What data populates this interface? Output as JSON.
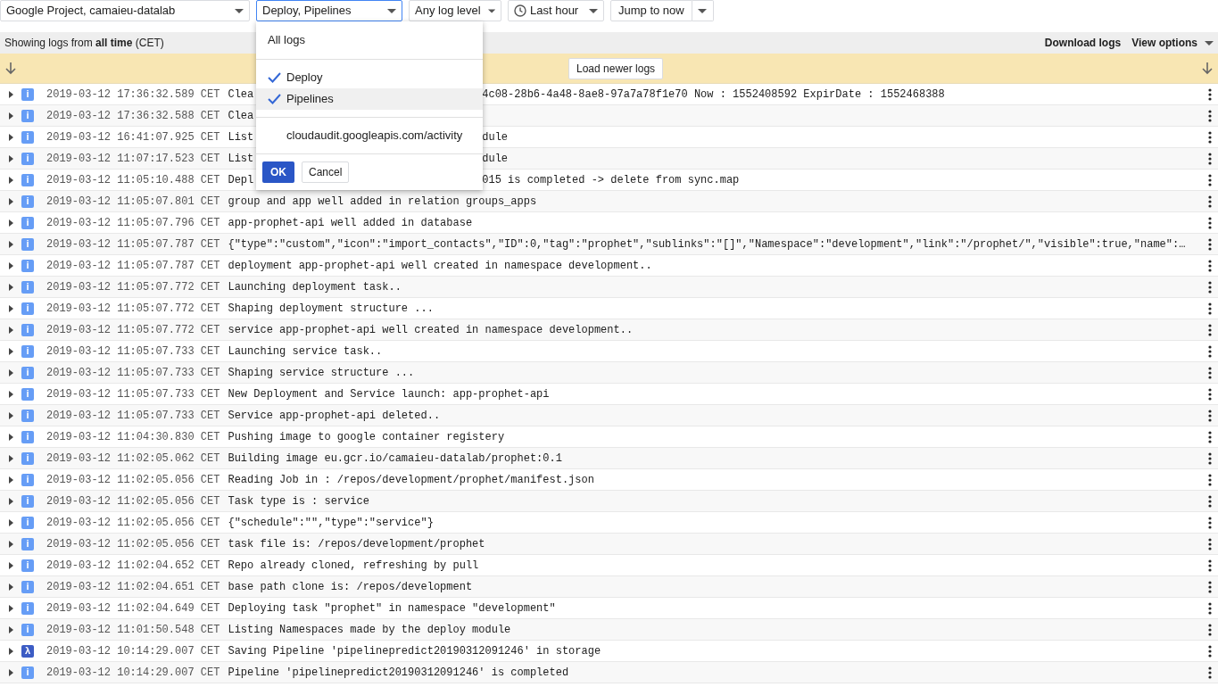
{
  "toolbar": {
    "selects": [
      {
        "label": "Google Project, camaieu-datalab",
        "open": false,
        "kind": "select"
      },
      {
        "label": "Deploy, Pipelines",
        "open": true,
        "kind": "select"
      },
      {
        "label": "Any log level",
        "open": false,
        "kind": "select"
      },
      {
        "label": "Last hour",
        "open": false,
        "kind": "time"
      },
      {
        "label": "Jump to now",
        "open": false,
        "kind": "split"
      }
    ]
  },
  "log_filter_menu": {
    "header": "All logs",
    "options": [
      {
        "label": "Deploy",
        "checked": true,
        "hovered": false
      },
      {
        "label": "Pipelines",
        "checked": true,
        "hovered": true
      },
      {
        "label": "cloudaudit.googleapis.com/activity",
        "checked": false,
        "hovered": false
      }
    ],
    "ok": "OK",
    "cancel": "Cancel"
  },
  "info_bar": {
    "prefix": "Showing logs from ",
    "range": "all time",
    "suffix": " (CET)",
    "actions": [
      "Download logs",
      "View options"
    ]
  },
  "newer_bar": {
    "button": "Load newer logs"
  },
  "rows": [
    {
      "kind": "info",
      "badge": "i",
      "time": "2019-03-12 17:36:32.589 CET",
      "message": "Clea",
      "tail": "4c08-28b6-4a48-8ae8-97a7a78f1e70 Now : 1552408592 ExpirDate : 1552468388"
    },
    {
      "kind": "info",
      "badge": "i",
      "time": "2019-03-12 17:36:32.588 CET",
      "message": "Clea"
    },
    {
      "kind": "info",
      "badge": "i",
      "time": "2019-03-12 16:41:07.925 CET",
      "message": "List",
      "tail": "dule"
    },
    {
      "kind": "info",
      "badge": "i",
      "time": "2019-03-12 11:07:17.523 CET",
      "message": "List",
      "tail": "dule"
    },
    {
      "kind": "info",
      "badge": "i",
      "time": "2019-03-12 11:05:10.488 CET",
      "message": "Depl",
      "tail": "015 is completed -> delete from sync.map"
    },
    {
      "kind": "info",
      "badge": "i",
      "time": "2019-03-12 11:05:07.801 CET",
      "message": "group and app well added in relation groups_apps"
    },
    {
      "kind": "info",
      "badge": "i",
      "time": "2019-03-12 11:05:07.796 CET",
      "message": "app-prophet-api well added in database"
    },
    {
      "kind": "info",
      "badge": "i",
      "time": "2019-03-12 11:05:07.787 CET",
      "message": "{\"type\":\"custom\",\"icon\":\"import_contacts\",\"ID\":0,\"tag\":\"prophet\",\"sublinks\":\"[]\",\"Namespace\":\"development\",\"link\":\"/prophet/\",\"visible\":true,\"name\":…"
    },
    {
      "kind": "info",
      "badge": "i",
      "time": "2019-03-12 11:05:07.787 CET",
      "message": "deployment app-prophet-api well created in namespace development.."
    },
    {
      "kind": "info",
      "badge": "i",
      "time": "2019-03-12 11:05:07.772 CET",
      "message": "Launching deployment task.."
    },
    {
      "kind": "info",
      "badge": "i",
      "time": "2019-03-12 11:05:07.772 CET",
      "message": "Shaping deployment structure ..."
    },
    {
      "kind": "info",
      "badge": "i",
      "time": "2019-03-12 11:05:07.772 CET",
      "message": "service app-prophet-api well created in namespace development.."
    },
    {
      "kind": "info",
      "badge": "i",
      "time": "2019-03-12 11:05:07.733 CET",
      "message": "Launching service task.."
    },
    {
      "kind": "info",
      "badge": "i",
      "time": "2019-03-12 11:05:07.733 CET",
      "message": "Shaping service structure ..."
    },
    {
      "kind": "info",
      "badge": "i",
      "time": "2019-03-12 11:05:07.733 CET",
      "message": "New Deployment and Service launch: app-prophet-api"
    },
    {
      "kind": "info",
      "badge": "i",
      "time": "2019-03-12 11:05:07.733 CET",
      "message": "Service app-prophet-api deleted.."
    },
    {
      "kind": "info",
      "badge": "i",
      "time": "2019-03-12 11:04:30.830 CET",
      "message": "Pushing image to google container registery"
    },
    {
      "kind": "info",
      "badge": "i",
      "time": "2019-03-12 11:02:05.062 CET",
      "message": "Building image eu.gcr.io/camaieu-datalab/prophet:0.1"
    },
    {
      "kind": "info",
      "badge": "i",
      "time": "2019-03-12 11:02:05.056 CET",
      "message": "Reading Job in : /repos/development/prophet/manifest.json"
    },
    {
      "kind": "info",
      "badge": "i",
      "time": "2019-03-12 11:02:05.056 CET",
      "message": "Task type is : service"
    },
    {
      "kind": "info",
      "badge": "i",
      "time": "2019-03-12 11:02:05.056 CET",
      "message": "{\"schedule\":\"\",\"type\":\"service\"}"
    },
    {
      "kind": "info",
      "badge": "i",
      "time": "2019-03-12 11:02:05.056 CET",
      "message": "task file is: /repos/development/prophet"
    },
    {
      "kind": "info",
      "badge": "i",
      "time": "2019-03-12 11:02:04.652 CET",
      "message": "Repo already cloned, refreshing by pull"
    },
    {
      "kind": "info",
      "badge": "i",
      "time": "2019-03-12 11:02:04.651 CET",
      "message": "base path clone is: /repos/development"
    },
    {
      "kind": "info",
      "badge": "i",
      "time": "2019-03-12 11:02:04.649 CET",
      "message": "Deploying task \"prophet\" in namespace \"development\""
    },
    {
      "kind": "info",
      "badge": "i",
      "time": "2019-03-12 11:01:50.548 CET",
      "message": "Listing Namespaces made by the deploy module"
    },
    {
      "kind": "lambda",
      "badge": "λ",
      "time": "2019-03-12 10:14:29.007 CET",
      "message": "Saving Pipeline 'pipelinepredict20190312091246' in storage"
    },
    {
      "kind": "info",
      "badge": "i",
      "time": "2019-03-12 10:14:29.007 CET",
      "message": "Pipeline 'pipelinepredict20190312091246' is completed"
    }
  ]
}
